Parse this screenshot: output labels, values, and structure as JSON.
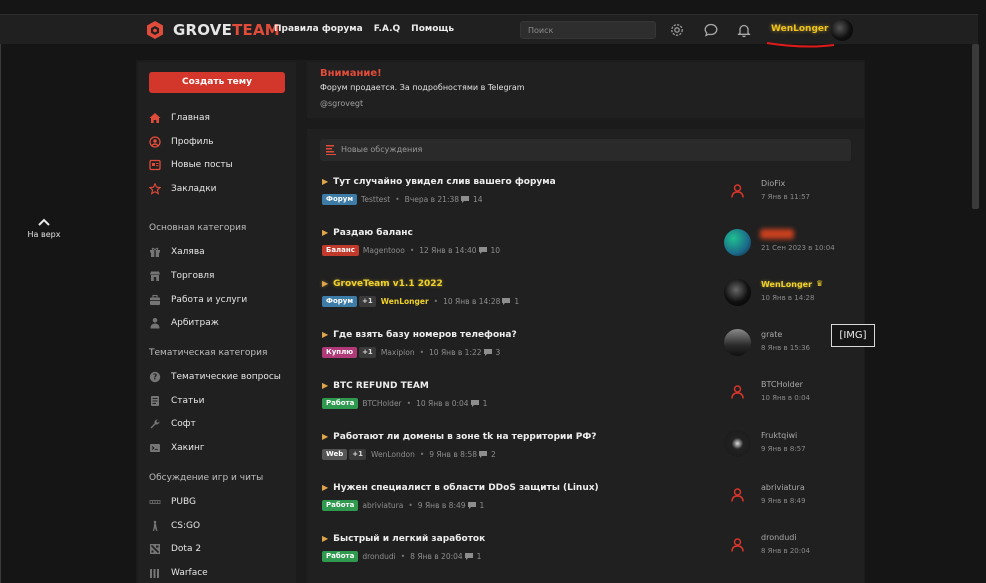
{
  "header": {
    "logo_part1": "GROVE",
    "logo_part2": "TEAM",
    "nav": [
      "Правила форума",
      "F.A.Q",
      "Помощь"
    ],
    "search_placeholder": "Поиск",
    "username": "WenLonger",
    "icons": [
      "settings-icon",
      "chat-icon",
      "bell-icon"
    ],
    "accent_color": "#e14b3a"
  },
  "to_top": "На верх",
  "sidebar": {
    "create_button": "Создать тему",
    "main_items": [
      {
        "label": "Главная",
        "icon": "home-icon"
      },
      {
        "label": "Профиль",
        "icon": "user-circle-icon"
      },
      {
        "label": "Новые посты",
        "icon": "new-posts-icon"
      },
      {
        "label": "Закладки",
        "icon": "star-icon"
      }
    ],
    "sections": [
      {
        "title": "Основная категория",
        "items": [
          "Халява",
          "Торговля",
          "Работа и услуги",
          "Арбитраж"
        ]
      },
      {
        "title": "Тематическая категория",
        "items": [
          "Тематические вопросы",
          "Статьи",
          "Софт",
          "Хакинг"
        ]
      },
      {
        "title": "Обсуждение игр и читы",
        "items": [
          "PUBG",
          "CS:GO",
          "Dota 2",
          "Warface"
        ]
      }
    ]
  },
  "notice": {
    "title": "Внимание!",
    "text": "Форум продается. За подробностями в Telegram",
    "link": "@sgrovegt"
  },
  "discussions": {
    "heading": "Новые обсуждения",
    "threads": [
      {
        "title": "Тут случайно увидел слив вашего форума",
        "tag": "Форум",
        "tag_color": "#3d7ca6",
        "plus": "",
        "author": "Testtest",
        "date": "Вчера в 21:38",
        "replies": "14",
        "last_user": "DioFix",
        "last_date": "7 Янв в 11:57"
      },
      {
        "title": "Раздаю баланс",
        "tag": "Баланс",
        "tag_color": "#c0392b",
        "plus": "",
        "author": "Magentooo",
        "date": "12 Янв в 14:40",
        "replies": "10",
        "last_user": "",
        "last_date": "21 Сен 2023 в 10:04"
      },
      {
        "title": "GroveTeam v1.1 2022",
        "tag": "Форум",
        "tag_color": "#3d7ca6",
        "plus": "+1",
        "author": "WenLonger",
        "date": "10 Янв в 14:28",
        "replies": "1",
        "last_user": "WenLonger",
        "last_date": "10 Янв в 14:28"
      },
      {
        "title": "Где взять базу номеров телефона?",
        "tag": "Куплю",
        "tag_color": "#b03a77",
        "plus": "+1",
        "author": "Maxipion",
        "date": "10 Янв в 1:22",
        "replies": "3",
        "last_user": "grate",
        "last_date": "8 Янв в 15:36"
      },
      {
        "title": "BTC REFUND TEAM",
        "tag": "Работа",
        "tag_color": "#2f9a4f",
        "plus": "",
        "author": "BTCHolder",
        "date": "10 Янв в 0:04",
        "replies": "1",
        "last_user": "BTCHolder",
        "last_date": "10 Янв в 0:04"
      },
      {
        "title": "Работают ли домены в зоне tk на территории РФ?",
        "tag": "Web",
        "tag_color": "#555555",
        "plus": "+1",
        "author": "WenLondon",
        "date": "9 Янв в 8:58",
        "replies": "2",
        "last_user": "Fruktqiwi",
        "last_date": "9 Янв в 8:57"
      },
      {
        "title": "Нужен специалист в области DDoS защиты (Linux)",
        "tag": "Работа",
        "tag_color": "#2f9a4f",
        "plus": "",
        "author": "abriviatura",
        "date": "9 Янв в 8:49",
        "replies": "1",
        "last_user": "abriviatura",
        "last_date": "9 Янв в 8:49"
      },
      {
        "title": "Быстрый и легкий заработок",
        "tag": "Работа",
        "tag_color": "#2f9a4f",
        "plus": "",
        "author": "drondudi",
        "date": "8 Янв в 20:04",
        "replies": "1",
        "last_user": "drondudi",
        "last_date": "8 Янв в 20:04"
      }
    ]
  },
  "img_placeholder": "[IMG]"
}
